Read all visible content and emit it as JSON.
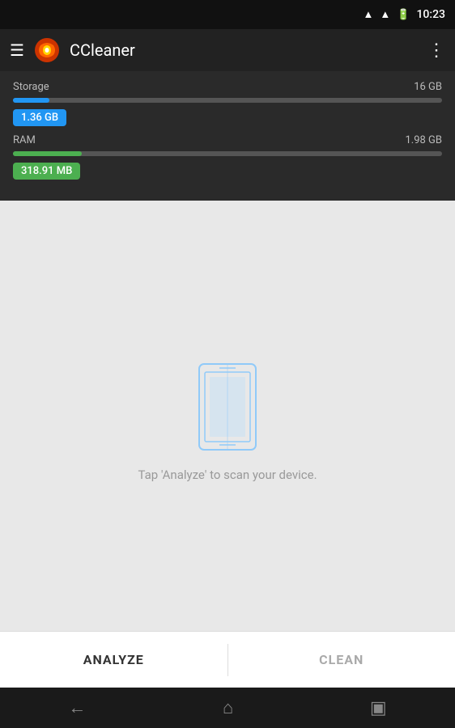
{
  "statusBar": {
    "time": "10:23",
    "wifiIcon": "wifi",
    "signalIcon": "signal",
    "batteryIcon": "battery"
  },
  "topBar": {
    "appTitle": "CCleaner",
    "menuIcon": "☰",
    "moreIcon": "⋮"
  },
  "stats": {
    "storage": {
      "label": "Storage",
      "total": "16 GB",
      "used": "1.36 GB",
      "fillPercent": 8.5
    },
    "ram": {
      "label": "RAM",
      "total": "1.98 GB",
      "used": "318.91 MB",
      "fillPercent": 16
    }
  },
  "mainContent": {
    "scanHint": "Tap 'Analyze' to scan your device."
  },
  "actionBar": {
    "analyzeLabel": "ANALYZE",
    "cleanLabel": "CLEAN"
  },
  "bottomNav": {
    "backIcon": "←",
    "homeIcon": "⌂",
    "recentIcon": "▣"
  }
}
